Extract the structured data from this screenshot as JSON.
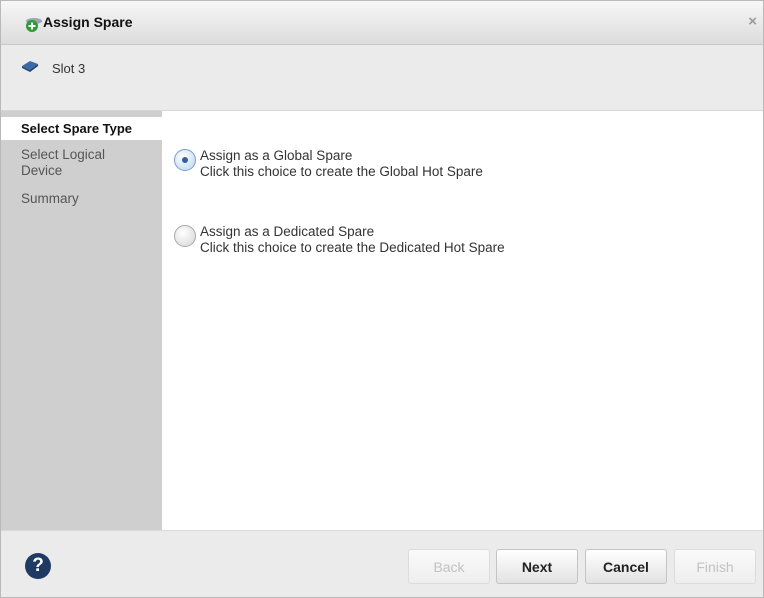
{
  "window": {
    "title": "Assign Spare",
    "close_symbol": "×"
  },
  "device": {
    "label": "Slot 3"
  },
  "steps": {
    "current": "Select Spare Type",
    "items": [
      "Select Logical Device",
      "Summary"
    ]
  },
  "options": [
    {
      "label": "Assign as a Global Spare",
      "description": "Click this choice to create the Global Hot Spare",
      "selected": true
    },
    {
      "label": "Assign as a Dedicated Spare",
      "description": "Click this choice to create the Dedicated Hot Spare",
      "selected": false
    }
  ],
  "footer": {
    "help_symbol": "?",
    "back": "Back",
    "next": "Next",
    "cancel": "Cancel",
    "finish": "Finish"
  },
  "colors": {
    "accent": "#2f5fa0",
    "help": "#1f3b63",
    "sidebar": "#cfcfcf"
  }
}
